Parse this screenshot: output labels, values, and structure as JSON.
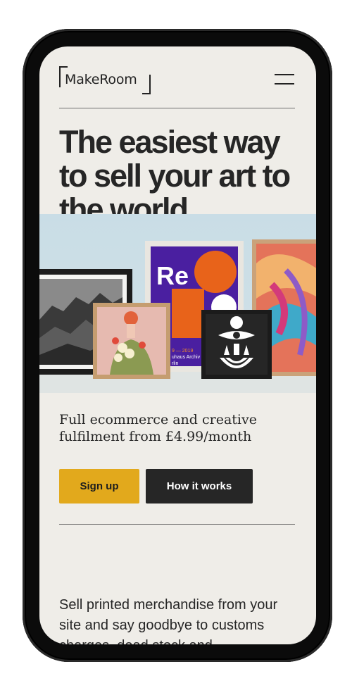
{
  "brand": {
    "logo_text": "MakeRoom"
  },
  "hero": {
    "headline": "The easiest way to sell your art to the world.",
    "poster_text_re": "Re",
    "poster_caption_1": "9 — 2019",
    "poster_caption_2": "uhaus Archiv",
    "poster_caption_3": "rlin"
  },
  "tagline": "Full ecommerce and creative fulfilment from £4.99/month",
  "buttons": {
    "signup": "Sign up",
    "how_it_works": "How it works"
  },
  "body_text": "Sell printed merchandise from your site and say goodbye to customs charges, dead stock and",
  "colors": {
    "background": "#efede8",
    "accent": "#e2a91c",
    "dark": "#262626",
    "phone_frame": "#0b0b0b"
  },
  "icons": {
    "menu": "hamburger-menu-icon"
  }
}
